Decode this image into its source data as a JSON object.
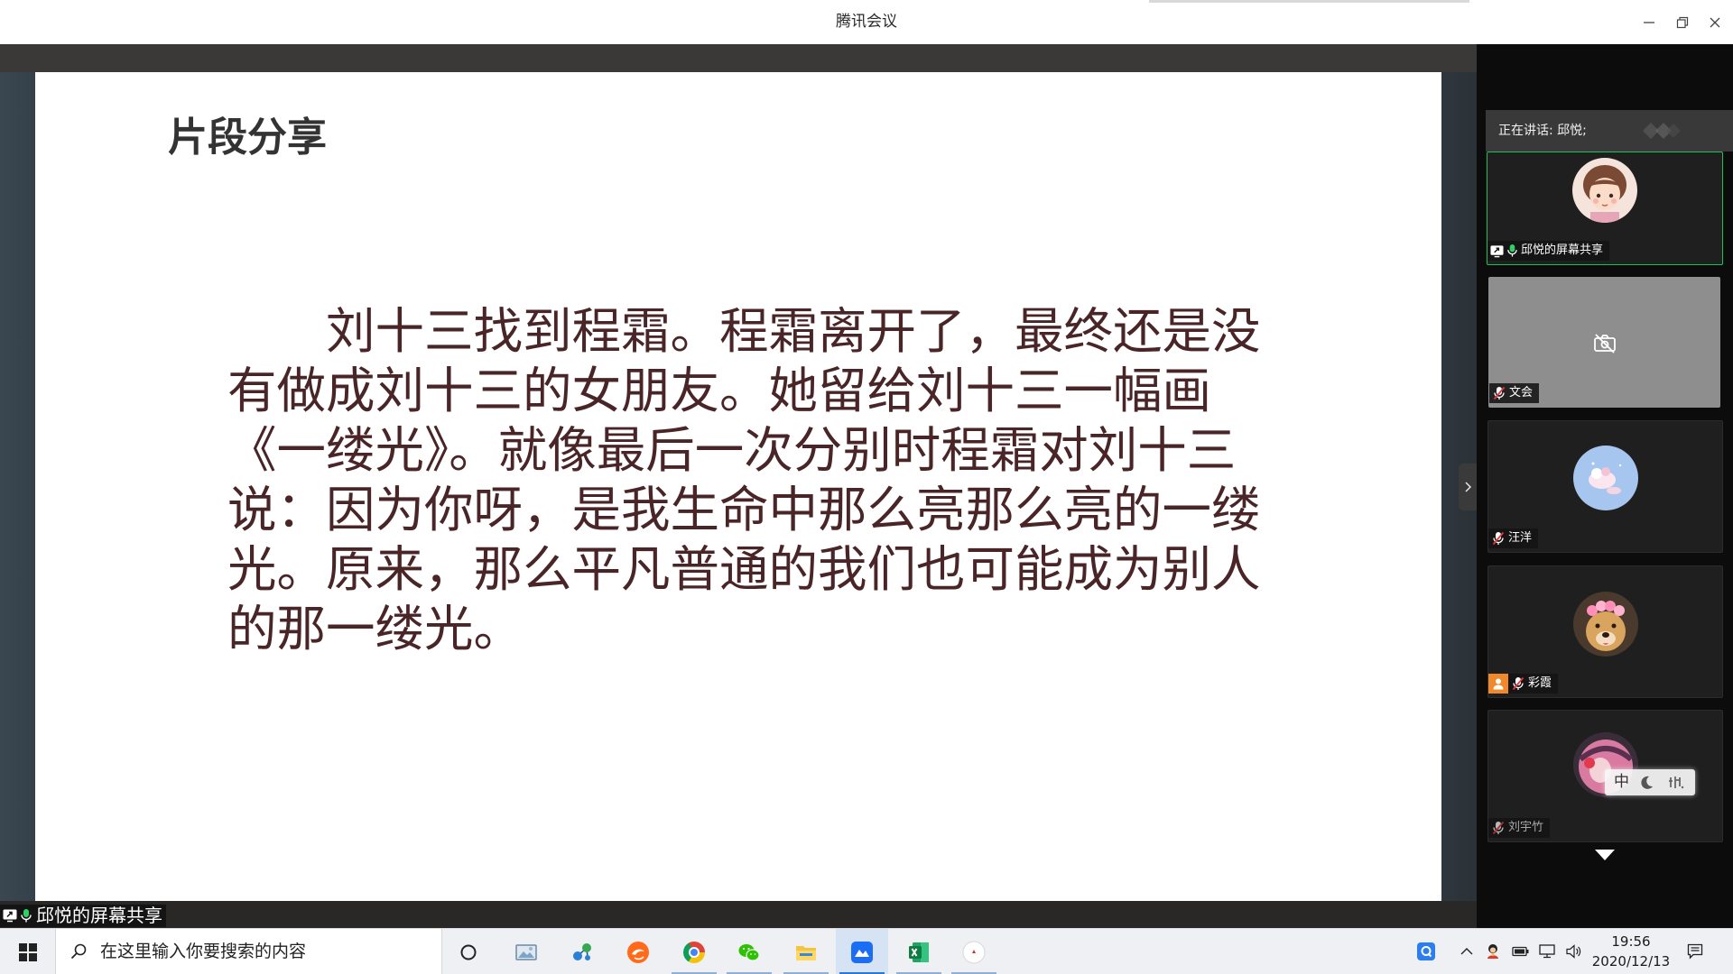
{
  "window": {
    "title": "腾讯会议",
    "controls": [
      "minimize-icon",
      "restore-icon",
      "close-icon"
    ]
  },
  "slide": {
    "title": "片段分享",
    "body_lines": [
      "刘十三找到程霜。程霜离开了，最终还是没",
      "有做成刘十三的女朋友。她留给刘十三一幅画",
      "《一缕光》。就像最后一次分别时程霜对刘十三",
      "说：因为你呀，是我生命中那么亮那么亮的一缕",
      "光。原来，那么平凡普通的我们也可能成为别人",
      "的那一缕光。"
    ]
  },
  "share_label": "邱悦的屏幕共享",
  "panel": {
    "speaking": "正在讲话: 邱悦;",
    "participants": [
      {
        "name": "邱悦的屏幕共享",
        "mic": "on",
        "sharing": true,
        "video": "avatar"
      },
      {
        "name": "文会",
        "mic": "muted",
        "video": "off"
      },
      {
        "name": "汪洋",
        "mic": "muted",
        "video": "avatar"
      },
      {
        "name": "彩霞",
        "mic": "muted",
        "video": "avatar",
        "role_icon": "person-icon"
      },
      {
        "name": "刘宇竹",
        "mic": "muted",
        "video": "avatar"
      }
    ]
  },
  "ime": {
    "mode": "中",
    "icons": [
      "half-width-moon-icon",
      "punctuation-icon"
    ]
  },
  "taskbar": {
    "search_placeholder": "在这里输入你要搜索的内容",
    "apps": [
      "photos-icon",
      "network-app-icon",
      "orange-swirl-app-icon",
      "chrome-icon",
      "wechat-icon",
      "file-explorer-icon",
      "tencent-meeting-icon",
      "excel-icon",
      "pinned-app-icon"
    ],
    "active_app": "tencent-meeting-icon",
    "tray": [
      "tencent-meeting-tray-icon",
      "chevron-up-icon",
      "tray-app-icon",
      "battery-icon",
      "network-icon",
      "volume-icon",
      "notification-icon"
    ],
    "clock": {
      "time": "19:56",
      "date": "2020/12/13"
    }
  },
  "colors": {
    "active_speaker_border": "#1fbf5b",
    "mic_on": "#2fd165",
    "mic_muted_slash": "#e5383b",
    "slide_text": "#4a2527",
    "meeting_blue": "#1b6ef3"
  }
}
